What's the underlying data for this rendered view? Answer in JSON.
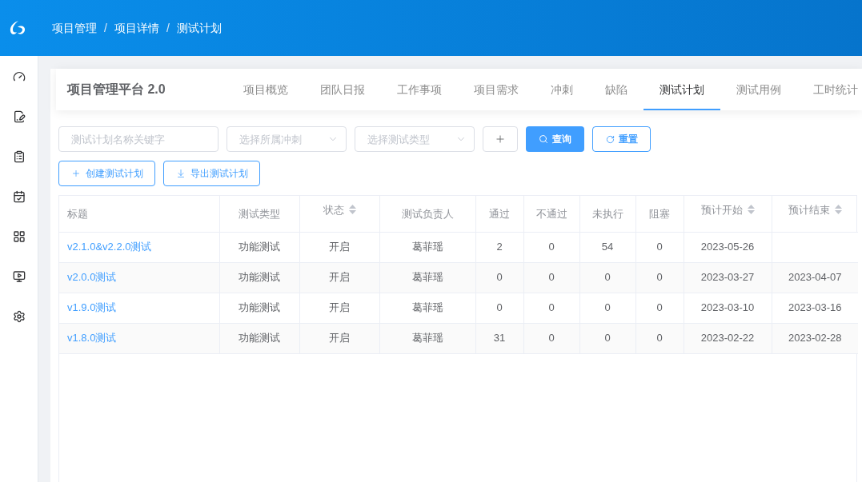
{
  "header": {
    "breadcrumb": [
      {
        "label": "项目管理",
        "separator": "/"
      },
      {
        "label": "项目详情",
        "separator": "/"
      },
      {
        "label": "测试计划"
      }
    ]
  },
  "project_bar": {
    "title": "项目管理平台 2.0",
    "tabs": [
      {
        "label": "项目概览",
        "selected": false
      },
      {
        "label": "团队日报",
        "selected": false
      },
      {
        "label": "工作事项",
        "selected": false
      },
      {
        "label": "项目需求",
        "selected": false
      },
      {
        "label": "冲刺",
        "selected": false
      },
      {
        "label": "缺陷",
        "selected": false
      },
      {
        "label": "测试计划",
        "selected": true
      },
      {
        "label": "测试用例",
        "selected": false
      },
      {
        "label": "工时统计",
        "selected": false
      }
    ]
  },
  "filters": {
    "keyword": {
      "placeholder": "测试计划名称关键字"
    },
    "sprint": {
      "placeholder": "选择所属冲刺"
    },
    "test_type": {
      "placeholder": "选择测试类型"
    },
    "search_button": {
      "label": "查询"
    },
    "reset_button": {
      "label": "重置"
    }
  },
  "actions": [
    {
      "kind": "create",
      "label": "创建测试计划"
    },
    {
      "kind": "export",
      "label": "导出测试计划"
    }
  ],
  "table": {
    "columns": [
      {
        "label": "标题",
        "sortable": false
      },
      {
        "label": "测试类型",
        "sortable": false
      },
      {
        "label": "状态",
        "sortable": true
      },
      {
        "label": "测试负责人",
        "sortable": false
      },
      {
        "label": "通过",
        "sortable": false
      },
      {
        "label": "不通过",
        "sortable": false
      },
      {
        "label": "未执行",
        "sortable": false
      },
      {
        "label": "阻塞",
        "sortable": false
      },
      {
        "label": "预计开始",
        "sortable": true
      },
      {
        "label": "预计结束",
        "sortable": true
      }
    ],
    "rows": [
      {
        "title": "v2.1.0&v2.2.0测试",
        "test_type": "功能测试",
        "status": "开启",
        "owner": "葛菲瑶",
        "passed": "2",
        "failed": "0",
        "not_run": "54",
        "blocked": "0",
        "planned_start": "2023-05-26"
      },
      {
        "title": "v2.0.0测试",
        "test_type": "功能测试",
        "status": "开启",
        "owner": "葛菲瑶",
        "passed": "0",
        "failed": "0",
        "not_run": "0",
        "blocked": "0",
        "planned_start": "2023-03-27",
        "planned_end": "2023-04-07"
      },
      {
        "title": "v1.9.0测试",
        "test_type": "功能测试",
        "status": "开启",
        "owner": "葛菲瑶",
        "passed": "0",
        "failed": "0",
        "not_run": "0",
        "blocked": "0",
        "planned_start": "2023-03-10",
        "planned_end": "2023-03-16"
      },
      {
        "title": "v1.8.0测试",
        "test_type": "功能测试",
        "status": "开启",
        "owner": "葛菲瑶",
        "passed": "31",
        "failed": "0",
        "not_run": "0",
        "blocked": "0",
        "planned_start": "2023-02-22",
        "planned_end": "2023-02-28"
      }
    ]
  }
}
